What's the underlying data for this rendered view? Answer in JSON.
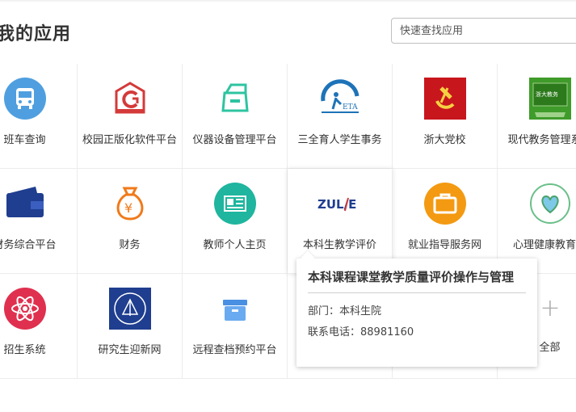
{
  "header": {
    "title": "我的应用",
    "search_placeholder": "快速查找应用"
  },
  "apps": [
    {
      "label": "班车查询",
      "icon": "bus-icon"
    },
    {
      "label": "校园正版化软件平台",
      "icon": "software-license-icon"
    },
    {
      "label": "仪器设备管理平台",
      "icon": "equipment-box-icon"
    },
    {
      "label": "三全育人学生事务",
      "icon": "eta-logo-icon"
    },
    {
      "label": "浙大党校",
      "icon": "party-emblem-icon"
    },
    {
      "label": "现代教务管理系统",
      "icon": "academic-affairs-icon"
    },
    {
      "label": "财务综合平台",
      "icon": "wallet-icon"
    },
    {
      "label": "财务",
      "icon": "money-bag-icon"
    },
    {
      "label": "教师个人主页",
      "icon": "newspaper-icon"
    },
    {
      "label": "本科生教学评价",
      "icon": "zuju-logo-icon",
      "logo_text": "ZUL / E"
    },
    {
      "label": "就业指导服务网",
      "icon": "briefcase-icon"
    },
    {
      "label": "心理健康教育网",
      "icon": "heart-seal-icon"
    },
    {
      "label": "招生系统",
      "icon": "atom-icon"
    },
    {
      "label": "研究生迎新网",
      "icon": "university-seal-icon"
    },
    {
      "label": "远程查档预约平台",
      "icon": "archive-box-icon"
    },
    {
      "label": "",
      "icon": "hidden"
    },
    {
      "label": "",
      "icon": "hidden"
    },
    {
      "label": "全部",
      "icon": "plus-icon"
    }
  ],
  "tooltip": {
    "title": "本科课程课堂教学质量评价操作与管理",
    "department_line": "部门：本科生院",
    "phone_line": "联系电话：88981160"
  },
  "colors": {
    "bus": "#4f9fe0",
    "software": "#d43a3a",
    "equipment": "#2ec4a0",
    "eta": "#1e73b8",
    "party": "#c8161d",
    "academic": "#3f9b2a",
    "wallet": "#1f3e8f",
    "money": "#f07a1a",
    "newspaper": "#1fb59e",
    "briefcase": "#f39a12",
    "atom": "#e0304f",
    "archive": "#4a90e2"
  }
}
